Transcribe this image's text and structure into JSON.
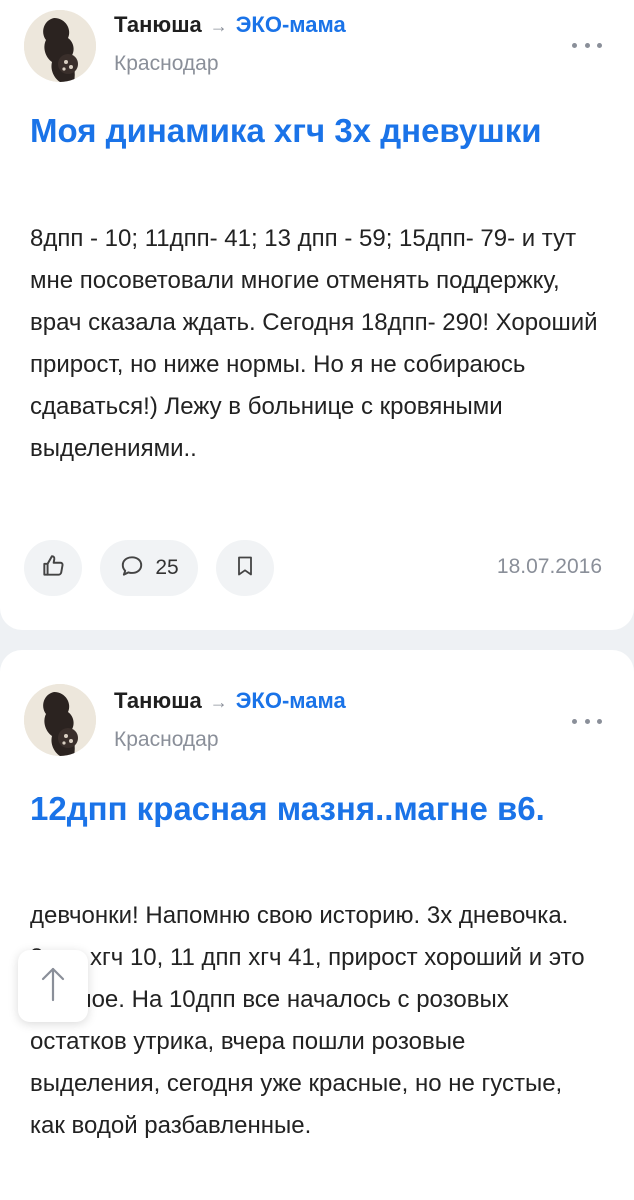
{
  "posts": [
    {
      "author": "Танюша",
      "arrow": "→",
      "community": "ЭКО-мама",
      "city": "Краснодар",
      "title": "Моя динамика хгч 3х дневушки",
      "body": "8дпп - 10; 11дпп- 41; 13 дпп - 59; 15дпп- 79- и тут мне посоветовали многие отменять поддержку, врач сказала ждать. Сегодня 18дпп- 290! Хороший прирост, но ниже нормы. Но я не собираюсь сдаваться!) Лежу в больнице с кровяными выделениями..",
      "comments_count": "25",
      "date": "18.07.2016",
      "icons": {
        "like": "thumbs-up-icon",
        "comment": "comment-icon",
        "save": "bookmark-icon",
        "more": "more-dots-icon"
      }
    },
    {
      "author": "Танюша",
      "arrow": "→",
      "community": "ЭКО-мама",
      "city": "Краснодар",
      "title": "12дпп красная мазня..магне в6.",
      "body": "девчонки! Напомню свою историю. 3х дневочка. 8дпп хгч 10, 11 дпп хгч 41, прирост хороший и это главное. На 10дпп все началось с розовых остатков утрика, вчера пошли розовые выделения, сегодня уже красные, но не густые, как водой разбавленные."
    }
  ],
  "scroll_top_icon": "arrow-up-icon",
  "colors": {
    "accent": "#1a73e8",
    "muted": "#8a8f99",
    "text": "#222222",
    "background": "#eef1f4"
  }
}
